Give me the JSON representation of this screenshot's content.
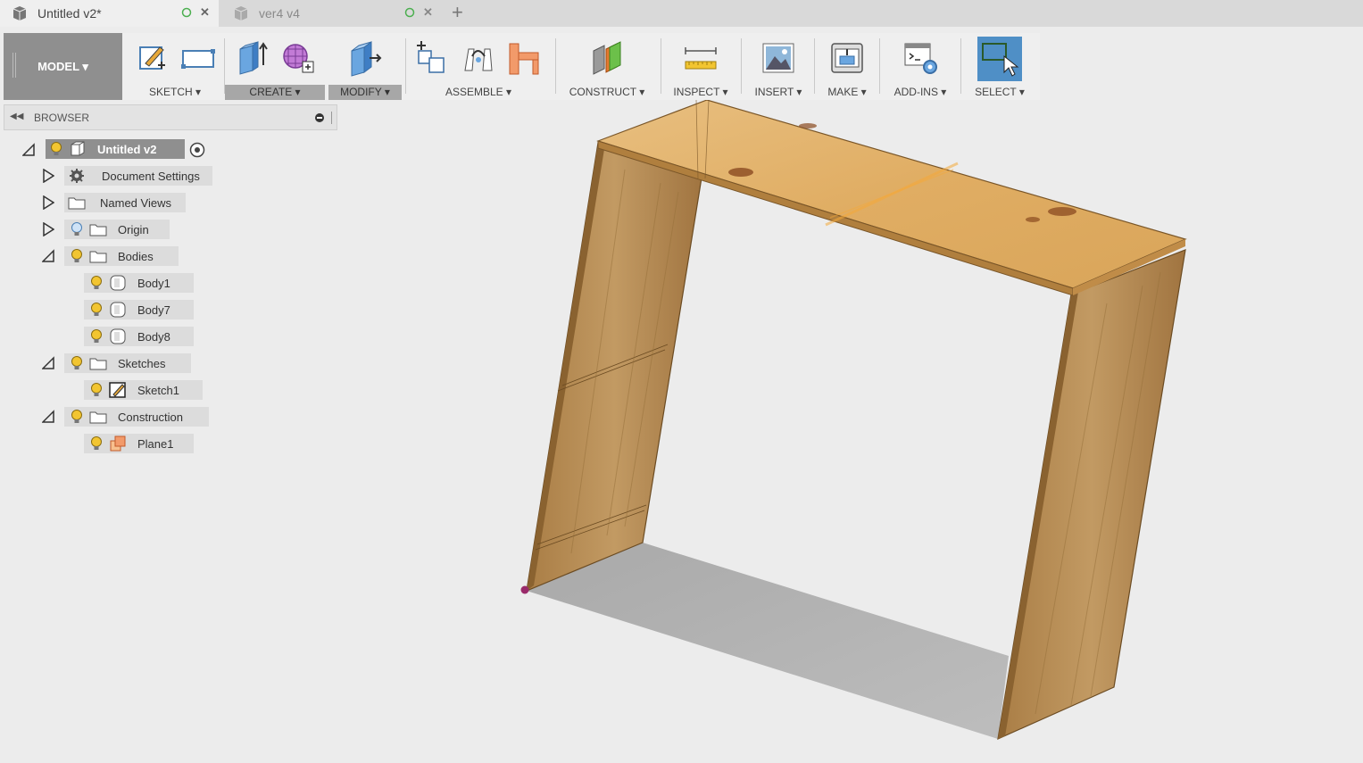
{
  "tabs": [
    {
      "title": "Untitled v2*",
      "active": true
    },
    {
      "title": "ver4 v4",
      "active": false
    }
  ],
  "toolbar": {
    "workspace": "MODEL ▾",
    "groups": [
      {
        "label": "SKETCH ▾"
      },
      {
        "label": "CREATE ▾"
      },
      {
        "label": "MODIFY ▾"
      },
      {
        "label": "ASSEMBLE ▾"
      },
      {
        "label": "CONSTRUCT ▾"
      },
      {
        "label": "INSPECT ▾"
      },
      {
        "label": "INSERT ▾"
      },
      {
        "label": "MAKE ▾"
      },
      {
        "label": "ADD-INS ▾"
      },
      {
        "label": "SELECT ▾"
      }
    ]
  },
  "browser": {
    "title": "BROWSER",
    "tree": {
      "root": "Untitled v2",
      "document_settings": "Document Settings",
      "named_views": "Named Views",
      "origin": "Origin",
      "bodies": "Bodies",
      "body1": "Body1",
      "body7": "Body7",
      "body8": "Body8",
      "sketches": "Sketches",
      "sketch1": "Sketch1",
      "construction": "Construction",
      "plane1": "Plane1"
    }
  },
  "colors": {
    "accent": "#5b8fbf",
    "wood": "#c99a5b",
    "wood_top": "#e3b46f",
    "bulb": "#f2c531",
    "model_bg": "#8f8f8f"
  }
}
